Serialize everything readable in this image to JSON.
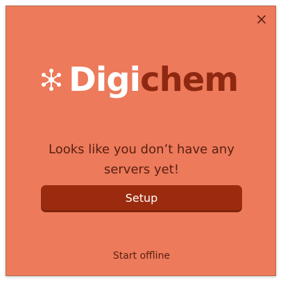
{
  "brand": {
    "name_part1": "Digi",
    "name_part2": "chem"
  },
  "message": "Looks like you don’t have any servers yet!",
  "buttons": {
    "setup": "Setup",
    "start_offline": "Start offline"
  },
  "icons": {
    "close": "close-icon",
    "logo": "molecule-icon"
  },
  "colors": {
    "background": "#ec7a5b",
    "accent": "#9b2b0e",
    "brand_dark": "#8f2810",
    "text": "#5a1e10"
  }
}
